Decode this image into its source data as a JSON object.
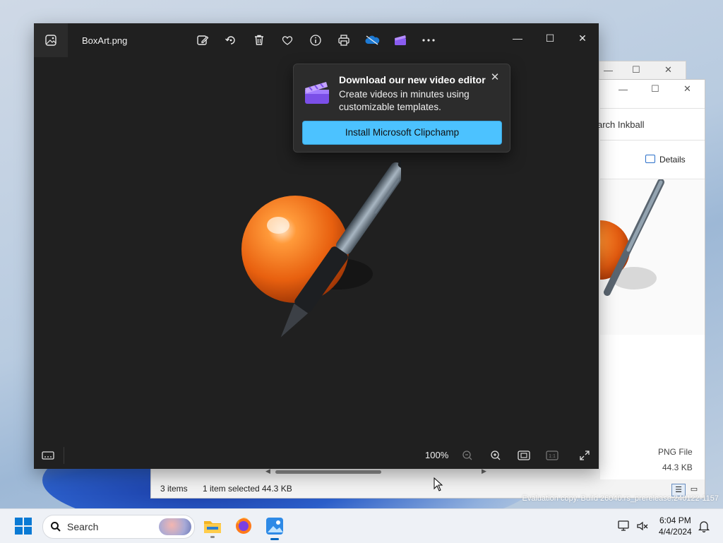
{
  "photos": {
    "title": "BoxArt.png",
    "toolbar": [
      "edit-image-icon",
      "rotate-icon",
      "delete-icon",
      "favorite-icon",
      "info-icon",
      "print-icon",
      "onedrive-icon",
      "clipchamp-icon",
      "more-icon"
    ],
    "zoom": "100%"
  },
  "flyout": {
    "title": "Download our new video editor",
    "description": "Create videos in minutes using customizable templates.",
    "button": "Install Microsoft Clipchamp"
  },
  "explorer": {
    "search_placeholder": "arch Inkball",
    "details_label": "Details",
    "file_type": "PNG File",
    "file_size": "44.3 KB",
    "status_items": "3 items",
    "status_selected": "1 item selected",
    "status_size": "44.3 KB"
  },
  "watermark": "Evaluation copy. Build 26040.rs_prerelease.240122-1157",
  "taskbar": {
    "search_label": "Search",
    "time": "6:04 PM",
    "date": "4/4/2024"
  },
  "colors": {
    "accent": "#4cc2ff",
    "photos_bg": "#202020",
    "taskbar": "#eef1f6"
  }
}
